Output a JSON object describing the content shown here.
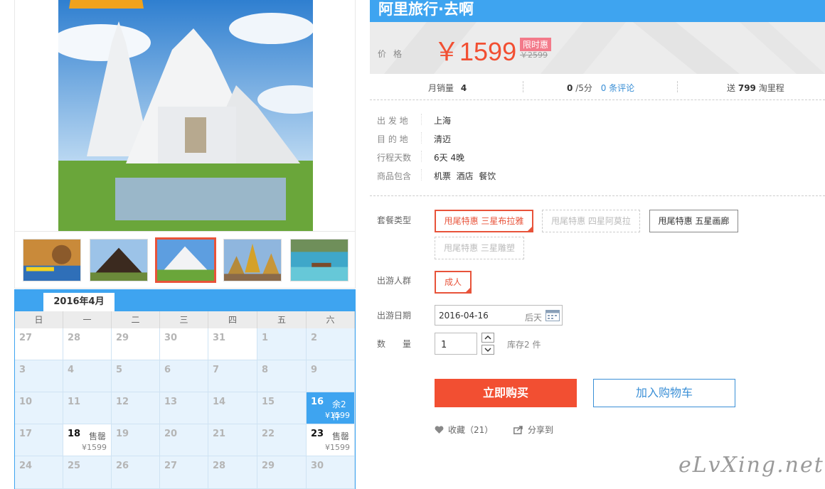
{
  "product": {
    "title": "阿里旅行·去啊",
    "price_label": "价格",
    "price": "￥1599",
    "promo_badge": "限时惠",
    "old_price": "￥2599"
  },
  "stats": {
    "monthly_sales_label": "月销量",
    "monthly_sales": "4",
    "rating": "0",
    "rating_suffix": "/5分",
    "reviews": "0 条评论",
    "points_prefix": "送",
    "points": "799",
    "points_suffix": "淘里程"
  },
  "info": [
    {
      "label": "出 发 地",
      "value": "上海"
    },
    {
      "label": "目 的 地",
      "value": "清迈"
    },
    {
      "label": "行程天数",
      "value": "6天 4晚"
    },
    {
      "label": "商品包含",
      "value": "机票  酒店  餐饮"
    }
  ],
  "options": {
    "package_label": "套餐类型",
    "packages": [
      {
        "label": "甩尾特惠 三星布拉雅",
        "state": "selected"
      },
      {
        "label": "甩尾特惠 四星阿莫拉",
        "state": "disabled"
      },
      {
        "label": "甩尾特惠 五星画廊",
        "state": "normal"
      },
      {
        "label": "甩尾特惠 三星雕塑",
        "state": "disabled"
      }
    ],
    "traveler_label": "出游人群",
    "traveler": "成人",
    "date_label": "出游日期",
    "date_value": "2016-04-16",
    "date_suffix": "后天",
    "qty_label": "数量",
    "qty_value": "1",
    "stock": "库存2 件"
  },
  "actions": {
    "buy": "立即购买",
    "cart": "加入购物车",
    "favorite": "收藏（21）",
    "share": "分享到"
  },
  "calendar": {
    "month": "2016年4月",
    "weekdays": [
      "日",
      "一",
      "二",
      "三",
      "四",
      "五",
      "六"
    ],
    "weeks": [
      [
        {
          "d": "27"
        },
        {
          "d": "28"
        },
        {
          "d": "29"
        },
        {
          "d": "30"
        },
        {
          "d": "31"
        },
        {
          "d": "1"
        },
        {
          "d": "2"
        }
      ],
      [
        {
          "d": "3"
        },
        {
          "d": "4"
        },
        {
          "d": "5"
        },
        {
          "d": "6"
        },
        {
          "d": "7"
        },
        {
          "d": "8"
        },
        {
          "d": "9"
        }
      ],
      [
        {
          "d": "10"
        },
        {
          "d": "11"
        },
        {
          "d": "12"
        },
        {
          "d": "13"
        },
        {
          "d": "14"
        },
        {
          "d": "15"
        },
        {
          "d": "16",
          "tag": "余2件",
          "price": "¥1599",
          "selected": true
        }
      ],
      [
        {
          "d": "17"
        },
        {
          "d": "18",
          "tag": "售罄",
          "price": "¥1599",
          "available": true
        },
        {
          "d": "19"
        },
        {
          "d": "20"
        },
        {
          "d": "21"
        },
        {
          "d": "22"
        },
        {
          "d": "23",
          "tag": "售罄",
          "price": "¥1599",
          "available": true
        }
      ],
      [
        {
          "d": "24"
        },
        {
          "d": "25"
        },
        {
          "d": "26"
        },
        {
          "d": "27"
        },
        {
          "d": "28"
        },
        {
          "d": "29"
        },
        {
          "d": "30"
        }
      ]
    ]
  },
  "thumbnails": [
    "thumb-tiger-poster",
    "thumb-dark-temple",
    "thumb-white-temple",
    "thumb-golden-pagoda",
    "thumb-beach-boat"
  ],
  "watermark": "eLvXing.net",
  "colors": {
    "accent_blue": "#3ea4f0",
    "price_red": "#f24f32",
    "link_blue": "#3a8fd6"
  }
}
